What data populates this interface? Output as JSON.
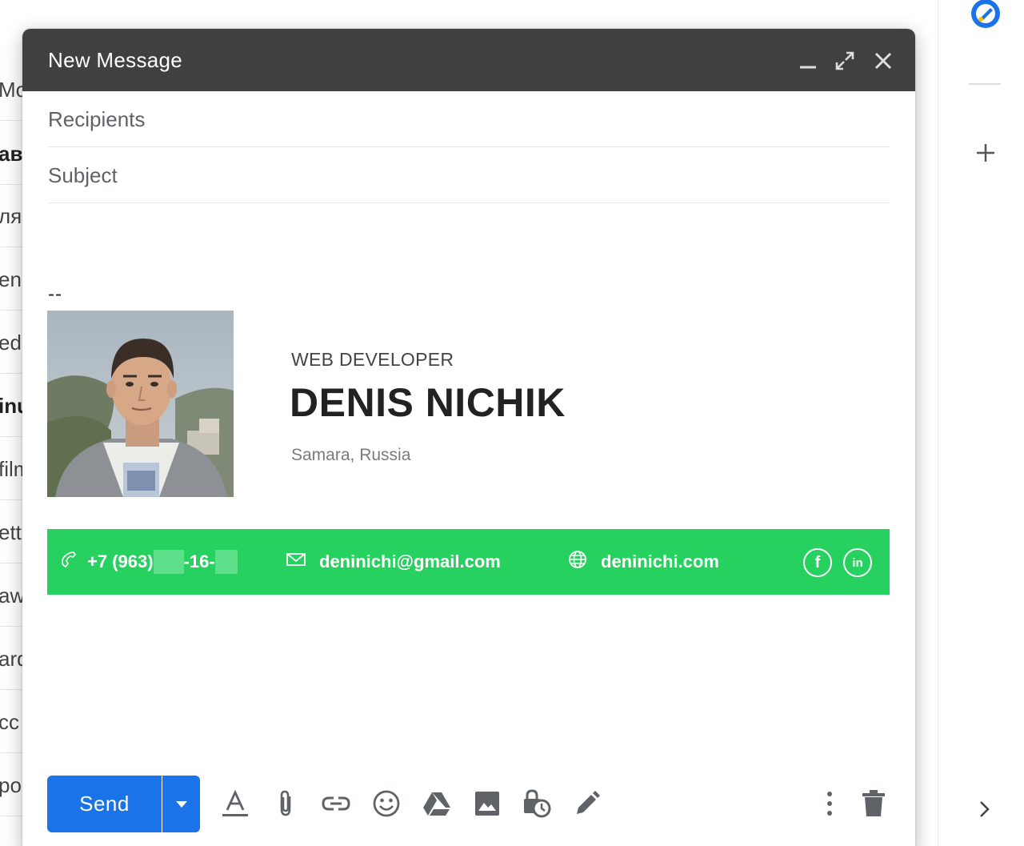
{
  "background_list": {
    "rows": [
      {
        "text": "Mo",
        "bold": false
      },
      {
        "text": "ави",
        "bold": true
      },
      {
        "text": "ля",
        "bold": false
      },
      {
        "text": "en",
        "bold": false
      },
      {
        "text": "ed",
        "bold": false
      },
      {
        "text": "inu",
        "bold": true
      },
      {
        "text": "film",
        "bold": false
      },
      {
        "text": "etti",
        "bold": false
      },
      {
        "text": "aw",
        "bold": false
      },
      {
        "text": "ard",
        "bold": false
      },
      {
        "text": "cc",
        "bold": false
      },
      {
        "text": "po",
        "bold": false
      }
    ]
  },
  "side_panel": {
    "icons": [
      "tasks-icon",
      "plus-icon",
      "chevron-right-icon"
    ],
    "tasks_color": "#1a73e8"
  },
  "compose": {
    "title": "New Message",
    "header_buttons": [
      "minimize-icon",
      "expand-icon",
      "close-icon"
    ],
    "header_color": "#404040",
    "recipients_placeholder": "Recipients",
    "subject_placeholder": "Subject",
    "body": {
      "separator": "--",
      "signature": {
        "role": "WEB DEVELOPER",
        "name": "DENIS NICHIK",
        "location": "Samara, Russia",
        "phone_prefix": "+7 (963)",
        "phone_mid": "-16-",
        "email": "deninichi@gmail.com",
        "website": "deninichi.com",
        "social": [
          "f",
          "in"
        ],
        "bar_color": "#26d15f"
      }
    },
    "toolbar": {
      "send_label": "Send",
      "send_color": "#1a73e8",
      "icons": [
        "formatting-icon",
        "attach-icon",
        "link-icon",
        "emoji-icon",
        "drive-icon",
        "photo-icon",
        "confidential-icon",
        "signature-icon",
        "more-options-icon",
        "discard-icon"
      ]
    }
  }
}
